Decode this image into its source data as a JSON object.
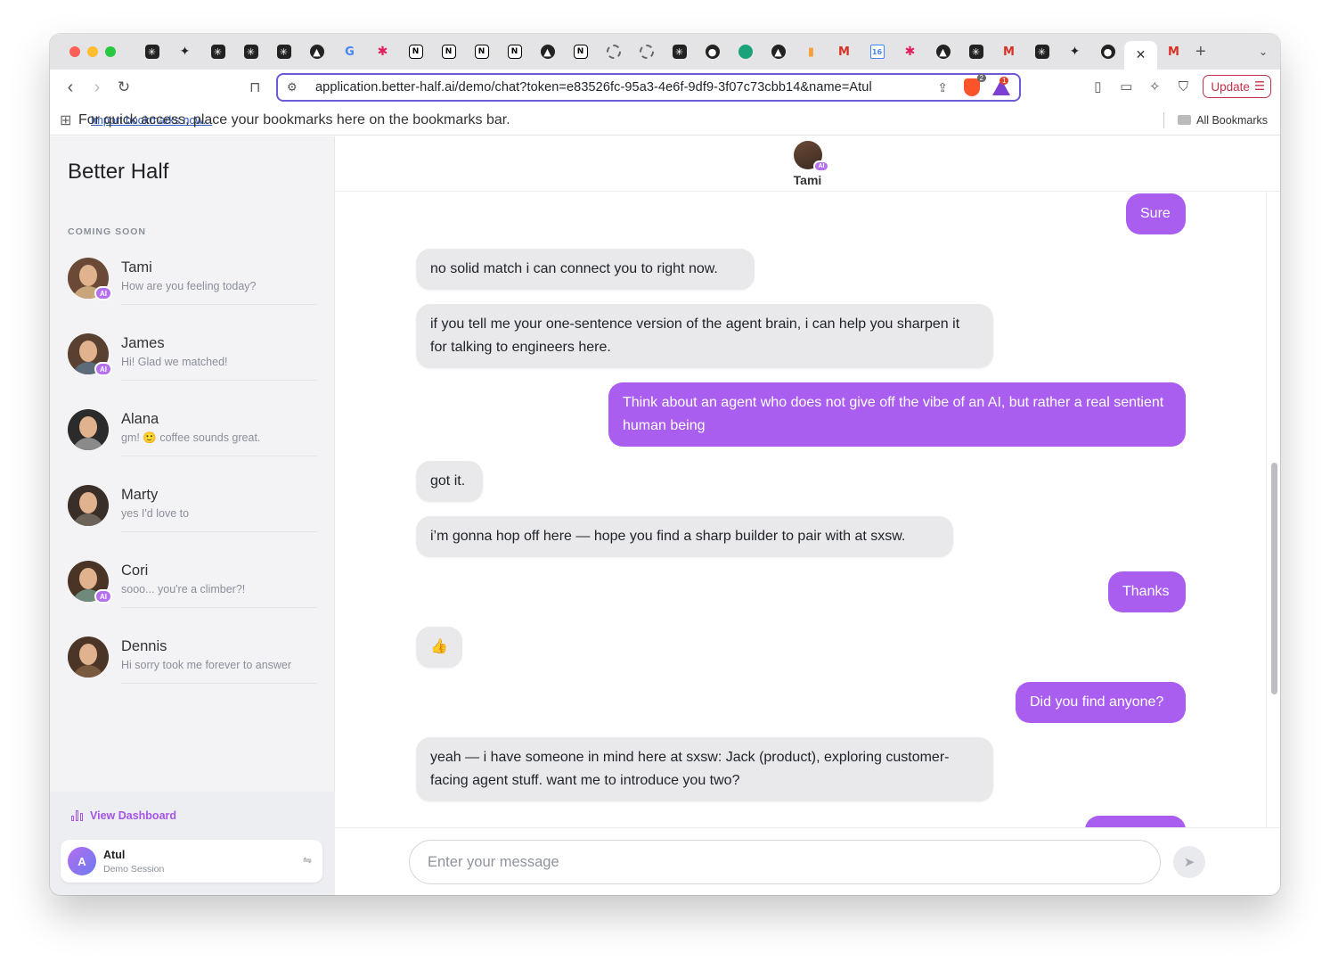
{
  "browser": {
    "url": "application.better-half.ai/demo/chat?token=e83526fc-95a3-4e6f-9df9-3f07c73cbb14&name=Atul",
    "brave_badge": "2",
    "rewards_badge": "1",
    "update_label": "Update",
    "bookmarks_msg": "For quick access, place your bookmarks here on the bookmarks bar.",
    "import_link": "Import bookmarks now...",
    "all_bookmarks": "All Bookmarks",
    "tabs": [
      "perplexity-icon",
      "sparkle-icon",
      "perplexity-icon",
      "perplexity-icon",
      "perplexity-icon",
      "vercel-icon",
      "google-icon",
      "slack-icon",
      "notion-icon",
      "notion-icon",
      "notion-icon",
      "notion-icon",
      "vercel-icon",
      "notion-icon",
      "chatgpt-icon",
      "chatgpt-icon",
      "perplexity-icon",
      "github-icon",
      "safari-icon",
      "vercel-icon",
      "analytics-icon",
      "gmail-icon",
      "calendar-icon",
      "slack-icon",
      "vercel-icon",
      "perplexity-icon",
      "gmail-icon",
      "perplexity-icon",
      "sparkle-icon",
      "github-icon",
      "active-tab",
      "gmail-icon"
    ],
    "calendar_day": "16",
    "new_tab": "+"
  },
  "sidebar": {
    "brand": "Better Half",
    "section_label": "COMING SOON",
    "contacts": [
      {
        "name": "Tami",
        "preview": "How are you feeling today?",
        "ai": true,
        "hair": "#6a4a36",
        "shirt": "#c9a57c"
      },
      {
        "name": "James",
        "preview": "Hi! Glad we matched!",
        "ai": true,
        "hair": "#5a4030",
        "shirt": "#5b6b7a"
      },
      {
        "name": "Alana",
        "preview": "gm! 🙂 coffee sounds great.",
        "ai": false,
        "hair": "#2b2b2b",
        "shirt": "#8a8a8a"
      },
      {
        "name": "Marty",
        "preview": "yes I'd love to",
        "ai": false,
        "hair": "#3a2e28",
        "shirt": "#6b625a"
      },
      {
        "name": "Cori",
        "preview": "sooo... you're a climber?!",
        "ai": true,
        "hair": "#4a3425",
        "shirt": "#6f8a7a"
      },
      {
        "name": "Dennis",
        "preview": "Hi sorry took me forever to answer",
        "ai": false,
        "hair": "#4a3527",
        "shirt": "#7a5a3e"
      }
    ],
    "ai_badge": "AI",
    "dashboard_label": "View Dashboard",
    "user": {
      "initial": "A",
      "name": "Atul",
      "session": "Demo Session"
    }
  },
  "chat": {
    "contact_name": "Tami",
    "messages": [
      {
        "dir": "out",
        "text": "Sure"
      },
      {
        "dir": "in",
        "text": "no solid match i can connect you to right now."
      },
      {
        "dir": "in",
        "text": "if you tell me your one-sentence version of the agent brain, i can help you sharpen it for talking to engineers here."
      },
      {
        "dir": "out",
        "text": "Think about an agent who does not give off the vibe of an AI, but rather a real sentient human being"
      },
      {
        "dir": "in",
        "text": "got it."
      },
      {
        "dir": "in",
        "text": "i’m gonna hop off here — hope you find a sharp builder to pair with at sxsw."
      },
      {
        "dir": "out",
        "text": "Thanks"
      },
      {
        "dir": "in",
        "text": "👍"
      },
      {
        "dir": "out",
        "text": "Did you find anyone?"
      },
      {
        "dir": "in",
        "text": "yeah — i have someone in mind here at sxsw: Jack (product), exploring customer-facing agent stuff. want me to introduce you two?"
      },
      {
        "dir": "out",
        "text": ""
      }
    ],
    "input_placeholder": "Enter your message"
  },
  "colors": {
    "accent": "#a95ef0",
    "incoming_bubble": "#e9e9eb",
    "sidebar_bg": "#f3f3f6"
  }
}
